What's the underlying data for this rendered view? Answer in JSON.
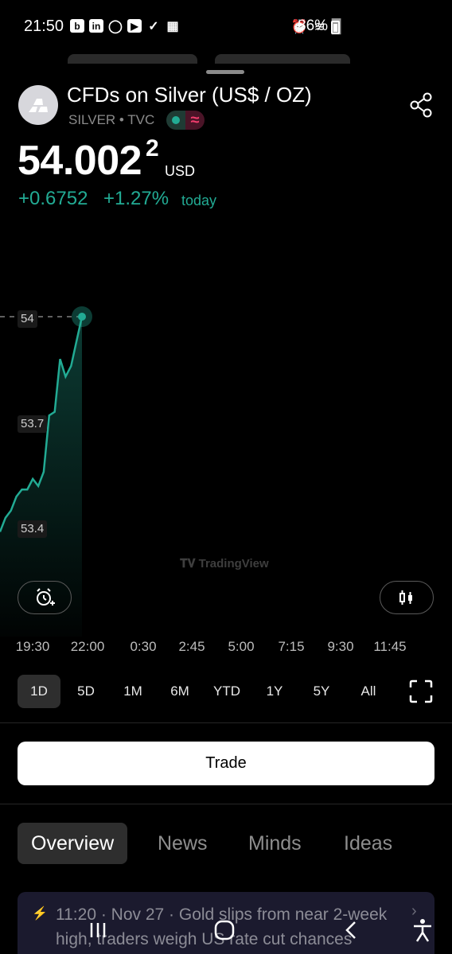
{
  "status_bar": {
    "time": "21:50",
    "app_icons": [
      "b",
      "in",
      "tray",
      "play",
      "check",
      "photo"
    ],
    "system_icons": [
      "alarm-icon",
      "wifi-icon",
      "signal-icon"
    ],
    "battery": "86%"
  },
  "header": {
    "title": "CFDs on Silver (US$ / OZ)",
    "subtitle": "SILVER • TVC",
    "logo": "silver-bars-icon",
    "share_icon": "share-icon"
  },
  "price": {
    "value": "54.002",
    "superscript": "2",
    "currency": "USD",
    "change_abs": "+0.6752",
    "change_pct": "+1.27%",
    "change_period": "today",
    "color_positive": "#22ab94"
  },
  "chart_data": {
    "type": "area",
    "y_ticks": [
      "54",
      "53.7",
      "53.4"
    ],
    "x_ticks": [
      "19:30",
      "22:00",
      "0:30",
      "2:45",
      "5:00",
      "7:15",
      "9:30",
      "11:45"
    ],
    "last_value": 54.0,
    "series": [
      {
        "values": [
          53.39,
          53.43,
          53.45,
          53.49,
          53.51,
          53.51,
          53.54,
          53.52,
          53.56,
          53.72,
          53.73,
          53.88,
          53.83,
          53.86,
          53.93,
          54.0
        ]
      }
    ],
    "line_color": "#22ab94",
    "ylim": [
      53.3,
      54.1
    ],
    "watermark": "TradingView"
  },
  "chart_controls": {
    "alert_icon": "alarm-plus-icon",
    "chart_type_icon": "candlestick-icon"
  },
  "ranges": {
    "items": [
      "1D",
      "5D",
      "1M",
      "6M",
      "YTD",
      "1Y",
      "5Y",
      "All"
    ],
    "active": "1D",
    "fullscreen_icon": "fullscreen-icon"
  },
  "trade": {
    "label": "Trade"
  },
  "tabs": {
    "items": [
      "Overview",
      "News",
      "Minds",
      "Ideas"
    ],
    "active": "Overview"
  },
  "news": {
    "headline": "11:20 · Nov 27 · Gold slips from near 2-week high, traders weigh US rate cut chances"
  },
  "nav": {
    "icons": [
      "recents-icon",
      "home-icon",
      "back-icon",
      "accessibility-icon"
    ]
  }
}
